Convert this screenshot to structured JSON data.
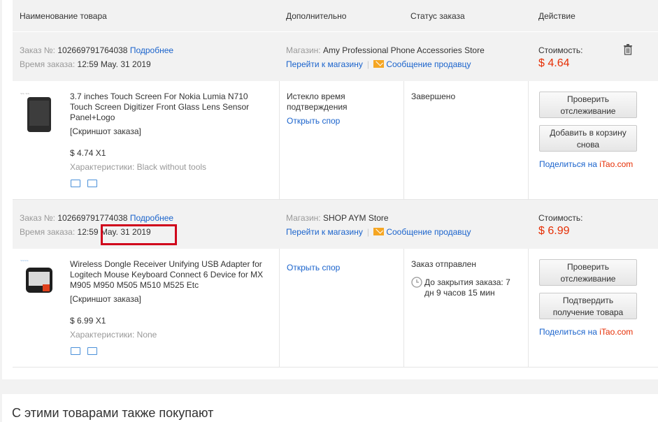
{
  "header": {
    "col_product": "Наименование товара",
    "col_extra": "Дополнительно",
    "col_status": "Статус заказа",
    "col_action": "Действие"
  },
  "orders": [
    {
      "order_label": "Заказ №:",
      "order_no": "102669791764038",
      "details_link": "Подробнее",
      "time_label": "Время заказа:",
      "time": "12:59",
      "date": "May. 31 2019",
      "store_label": "Магазин:",
      "store_name": "Amy Professional Phone Accessories Store",
      "go_store": "Перейти к магазину",
      "sep": "|",
      "msg_seller": "Сообщение продавцу",
      "cost_label": "Стоимость:",
      "cost": "$ 4.64",
      "item_title_1": "3.7 inches Touch Screen For Nokia Lumia N710",
      "item_title_2": "Touch Screen Digitizer Front Glass Lens Sensor",
      "item_title_3": "Panel+Logo",
      "screenshot": "[Скриншот заказа]",
      "price_qty": "$ 4.74 X1",
      "chars_label": "Характеристики:",
      "chars": "Black without tools",
      "extra_1": "Истекло время",
      "extra_2": "подтверждения",
      "dispute": "Открыть спор",
      "status": "Завершено",
      "btn1_1": "Проверить",
      "btn1_2": "отслеживание",
      "btn2_1": "Добавить в корзину",
      "btn2_2": "снова",
      "share": "Поделиться на",
      "itao": "iTao.com"
    },
    {
      "order_label": "Заказ №:",
      "order_no": "102669791774038",
      "details_link": "Подробнее",
      "time_label": "Время заказа:",
      "time": "12:59",
      "date": "May. 31 2019",
      "store_label": "Магазин:",
      "store_name": "SHOP AYM Store",
      "go_store": "Перейти к магазину",
      "sep": "|",
      "msg_seller": "Сообщение продавцу",
      "cost_label": "Стоимость:",
      "cost": "$ 6.99",
      "item_title_1": "Wireless Dongle Receiver Unifying USB Adapter for",
      "item_title_2": "Logitech Mouse Keyboard Connect 6 Device for MX",
      "item_title_3": "M905 M950 M505 M510 M525 Etc",
      "screenshot": "[Скриншот заказа]",
      "price_qty": "$ 6.99 X1",
      "chars_label": "Характеристики:",
      "chars": "None",
      "dispute": "Открыть спор",
      "status": "Заказ отправлен",
      "close_1": "До закрытия заказа: 7",
      "close_2": "дн 9 часов 15 мин",
      "btn1_1": "Проверить",
      "btn1_2": "отслеживание",
      "btn2_1": "Подтвердить",
      "btn2_2": "получение товара",
      "share": "Поделиться на",
      "itao": "iTao.com"
    }
  ],
  "also_bought": "С этими товарами также покупают",
  "colors": {
    "accent_blue": "#1a63cc",
    "price_red": "#e62e04",
    "highlight_red": "#d0021b"
  }
}
